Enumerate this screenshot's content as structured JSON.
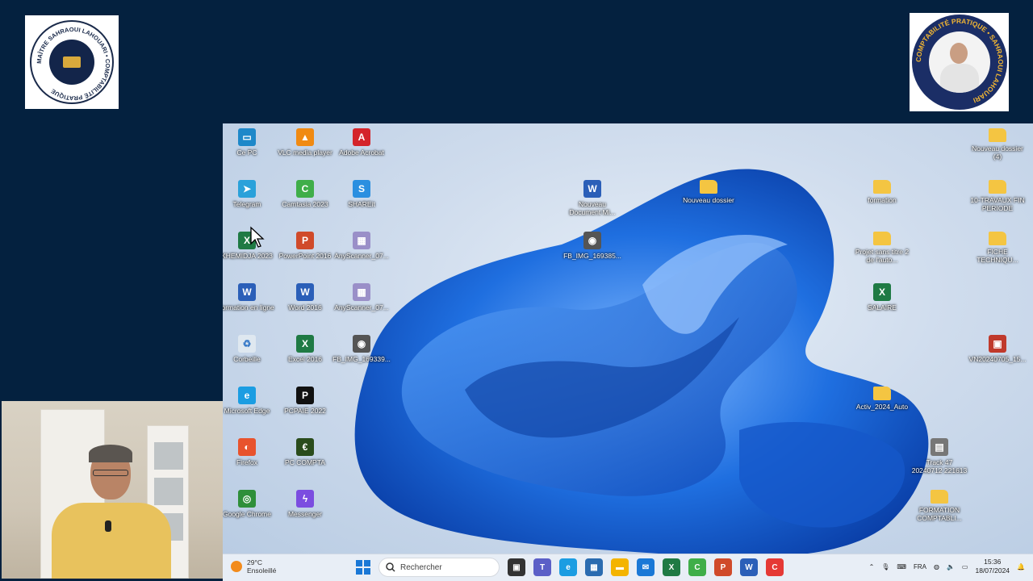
{
  "desktop_icons": [
    {
      "label": "Ce PC",
      "icon": "computer-icon",
      "color": "#1e88c9",
      "glyph": "▭"
    },
    {
      "label": "VLC media player",
      "icon": "vlc-icon",
      "color": "#f08a12",
      "glyph": "▲"
    },
    {
      "label": "Adobe Acrobat",
      "icon": "acrobat-icon",
      "color": "#d4242a",
      "glyph": "A"
    },
    {
      "label": "Telegram",
      "icon": "telegram-icon",
      "color": "#2aa1da",
      "glyph": "➤"
    },
    {
      "label": "Camtasia 2023",
      "icon": "camtasia-icon",
      "color": "#3fae49",
      "glyph": "C"
    },
    {
      "label": "SHAREit",
      "icon": "shareit-icon",
      "color": "#2b8fe0",
      "glyph": "S"
    },
    {
      "label": "KHEMIDJA 2023",
      "icon": "excel-file-icon",
      "color": "#1f7a44",
      "glyph": "X"
    },
    {
      "label": "PowerPoint 2016",
      "icon": "powerpoint-icon",
      "color": "#d04a2a",
      "glyph": "P"
    },
    {
      "label": "AnyScanner_07...",
      "icon": "image-file-icon",
      "color": "#9a8fc8",
      "glyph": "▦"
    },
    {
      "label": "formation en ligne",
      "icon": "word-file-icon",
      "color": "#2b5fb8",
      "glyph": "W"
    },
    {
      "label": "Word 2016",
      "icon": "word-icon",
      "color": "#2b5fb8",
      "glyph": "W"
    },
    {
      "label": "AnyScanner_07...",
      "icon": "image-file-icon",
      "color": "#9a8fc8",
      "glyph": "▦"
    },
    {
      "label": "Corbeille",
      "icon": "recycle-bin-icon",
      "color": "#dfe8f0",
      "glyph": "♻"
    },
    {
      "label": "Excel 2016",
      "icon": "excel-icon",
      "color": "#1f7a44",
      "glyph": "X"
    },
    {
      "label": "FB_IMG_169339...",
      "icon": "photo-file-icon",
      "color": "#555555",
      "glyph": "◉"
    },
    {
      "label": "Microsoft Edge",
      "icon": "edge-icon",
      "color": "#1b9de2",
      "glyph": "e"
    },
    {
      "label": "PCPAIE 2022",
      "icon": "pcpaie-icon",
      "color": "#111111",
      "glyph": "P"
    },
    {
      "label": "Firefox",
      "icon": "firefox-icon",
      "color": "#e8532d",
      "glyph": "◐"
    },
    {
      "label": "PC COMPTA",
      "icon": "pccompta-icon",
      "color": "#2a4c1c",
      "glyph": "€"
    },
    {
      "label": "Google Chrome",
      "icon": "chrome-icon",
      "color": "#2f8f3a",
      "glyph": "◎"
    },
    {
      "label": "Messenger",
      "icon": "messenger-icon",
      "color": "#7b4de0",
      "glyph": "ϟ"
    },
    {
      "label": "Nouveau Document Mi...",
      "icon": "word-file-icon",
      "color": "#2b5fb8",
      "glyph": "W"
    },
    {
      "label": "Nouveau dossier",
      "icon": "folder-icon",
      "color": "#f4c542",
      "glyph": ""
    },
    {
      "label": "FB_IMG_169385...",
      "icon": "photo-file-icon",
      "color": "#555555",
      "glyph": "◉"
    },
    {
      "label": "formation",
      "icon": "folder-icon",
      "color": "#f4c542",
      "glyph": ""
    },
    {
      "label": "Projet sans titre 2 de l'auto...",
      "icon": "folder-icon",
      "color": "#f4c542",
      "glyph": ""
    },
    {
      "label": "SALAIRE",
      "icon": "excel-file-icon",
      "color": "#1f7a44",
      "glyph": "X"
    },
    {
      "label": "Activ_2024_Auto",
      "icon": "folder-icon",
      "color": "#f4c542",
      "glyph": ""
    },
    {
      "label": "Nouveau dossier (4)",
      "icon": "folder-icon",
      "color": "#f4c542",
      "glyph": ""
    },
    {
      "label": "10-TRAVAUX FIN PERIODE",
      "icon": "folder-icon",
      "color": "#f4c542",
      "glyph": ""
    },
    {
      "label": "FICHE TECHNIQU...",
      "icon": "folder-icon",
      "color": "#f4c542",
      "glyph": ""
    },
    {
      "label": "VN20240705_15...",
      "icon": "image-file-icon",
      "color": "#c0392b",
      "glyph": "▣"
    },
    {
      "label": "Track 47 20240712 221613",
      "icon": "media-file-icon",
      "color": "#777777",
      "glyph": "▤"
    },
    {
      "label": "FORMATION COMPTABLI...",
      "icon": "folder-icon",
      "color": "#f4c542",
      "glyph": ""
    }
  ],
  "taskbar": {
    "weather_temp": "29°C",
    "weather_desc": "Ensoleillé",
    "search_placeholder": "Rechercher",
    "apps": [
      {
        "name": "task-view",
        "color": "#333333",
        "glyph": "▣"
      },
      {
        "name": "teams",
        "color": "#5b5fc7",
        "glyph": "T"
      },
      {
        "name": "edge",
        "color": "#1b9de2",
        "glyph": "e"
      },
      {
        "name": "store",
        "color": "#2b6cb0",
        "glyph": "▦"
      },
      {
        "name": "explorer",
        "color": "#f4b400",
        "glyph": "▬"
      },
      {
        "name": "mail",
        "color": "#1a78d6",
        "glyph": "✉"
      },
      {
        "name": "excel",
        "color": "#1f7a44",
        "glyph": "X"
      },
      {
        "name": "camtasia",
        "color": "#3fae49",
        "glyph": "C"
      },
      {
        "name": "powerpoint",
        "color": "#d04a2a",
        "glyph": "P"
      },
      {
        "name": "word",
        "color": "#2b5fb8",
        "glyph": "W"
      },
      {
        "name": "camtasia-recorder",
        "color": "#e53935",
        "glyph": "C"
      }
    ],
    "language": "FRA",
    "time": "15:36",
    "date": "18/07/2024"
  },
  "logos": {
    "left_text": "MAÎTRE SAHRAOUI LAHOUARI • COMPTABILITÉ PRATIQUE",
    "right_text": "COMPTABILITÉ PRATIQUE • SAHRAOUI LAHOUARI"
  }
}
